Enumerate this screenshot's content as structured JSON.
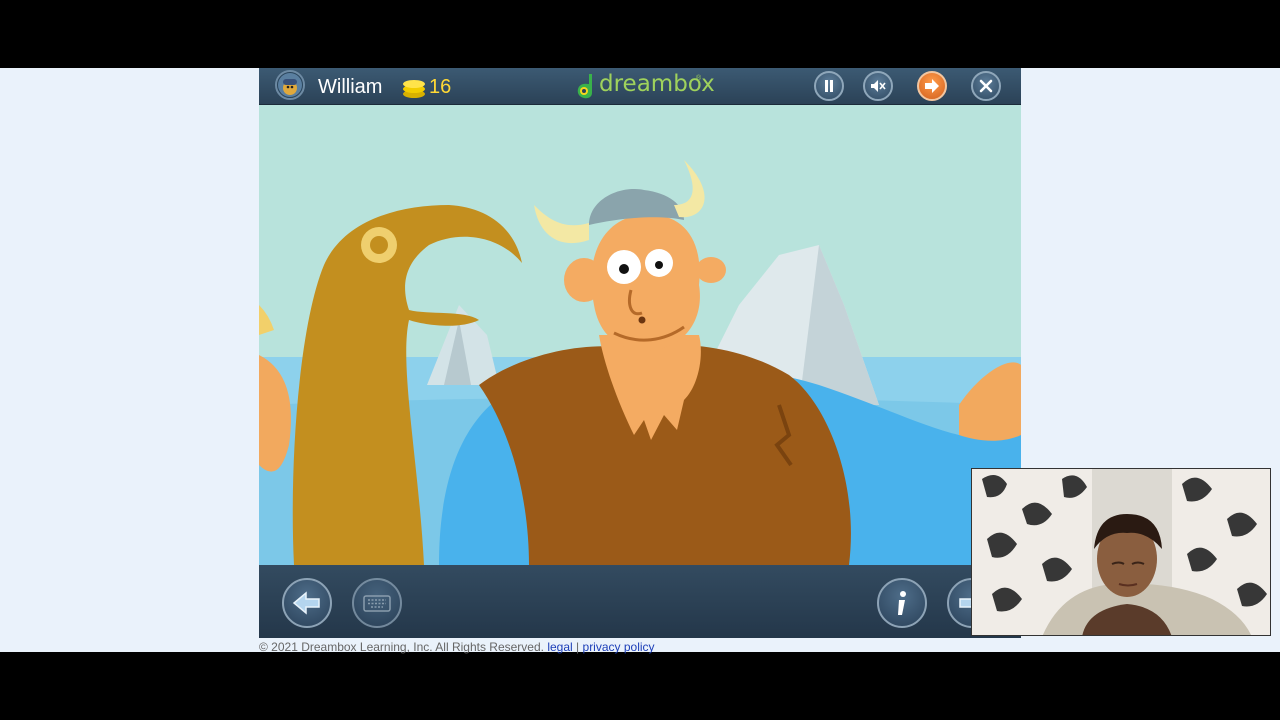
{
  "header": {
    "username": "William",
    "coins": "16",
    "logo_text": "dreambox",
    "logo_mark": "®",
    "buttons": [
      {
        "name": "pause",
        "icon": "pause-icon"
      },
      {
        "name": "mute",
        "icon": "speaker-muted-icon"
      },
      {
        "name": "next",
        "icon": "arrow-right-icon"
      },
      {
        "name": "close",
        "icon": "close-icon"
      }
    ]
  },
  "bottom_bar": {
    "buttons": [
      {
        "name": "back",
        "icon": "arrow-left-icon"
      },
      {
        "name": "keyboard",
        "icon": "keyboard-icon"
      },
      {
        "name": "info",
        "icon": "info-icon"
      }
    ]
  },
  "footer": {
    "copyright": "© 2021 Dreambox Learning, Inc. All Rights Reserved.",
    "legal": "legal",
    "separator": "|",
    "privacy": "privacy policy"
  },
  "colors": {
    "header_bg": "#2f4a62",
    "logo_green": "#9fd25c",
    "coin_yellow": "#ffd935",
    "next_button_orange": "#e6772b",
    "page_bg": "#eaf2fb"
  }
}
